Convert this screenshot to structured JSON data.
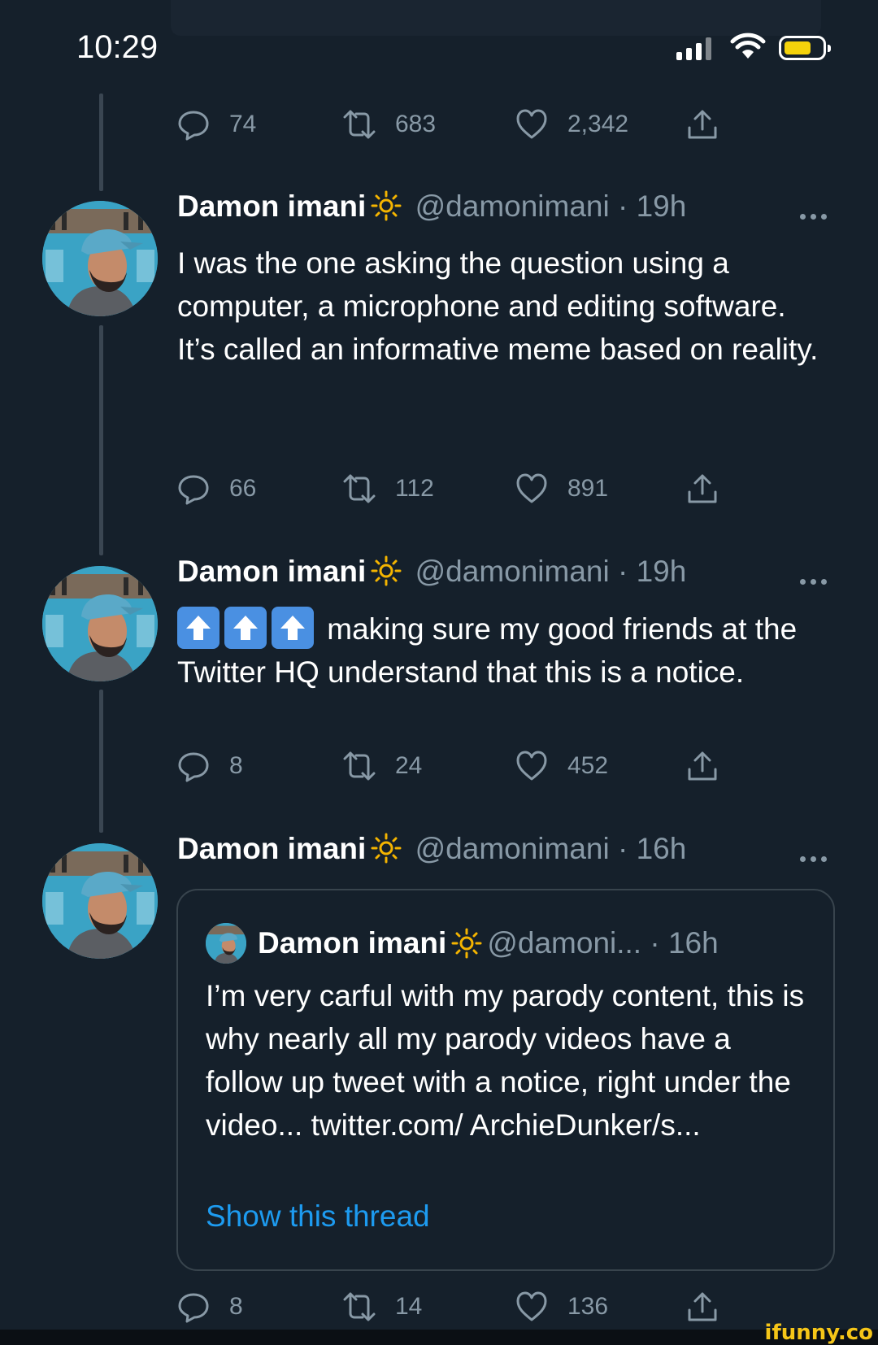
{
  "status_bar": {
    "time": "10:29"
  },
  "colors": {
    "background": "#15202b",
    "accent": "#1d9bf0",
    "muted": "#8899a6",
    "battery": "#f4d20b"
  },
  "tweets": [
    {
      "actions": {
        "replies": "74",
        "retweets": "683",
        "likes": "2,342"
      }
    },
    {
      "author": {
        "name": "Damon imani",
        "handle": "@damonimani",
        "time": "· 19h"
      },
      "text": [
        "I was the one asking the question using a computer, a microphone and editing software.",
        "It’s called an informative meme based on reality."
      ],
      "actions": {
        "replies": "66",
        "retweets": "112",
        "likes": "891"
      }
    },
    {
      "author": {
        "name": "Damon imani",
        "handle": "@damonimani",
        "time": "· 19h"
      },
      "text": [
        "making sure my good friends at the Twitter HQ understand that this is a notice."
      ],
      "actions": {
        "replies": "8",
        "retweets": "24",
        "likes": "452"
      }
    },
    {
      "author": {
        "name": "Damon imani",
        "handle": "@damonimani",
        "time": "· 16h"
      },
      "quote": {
        "name": "Damon imani",
        "handle": "@damoni...",
        "time": "· 16h",
        "text": "I’m very carful with my parody content, this is why nearly all my parody videos have a follow up tweet with a notice, right under the video... twitter.com/ ArchieDunker/s...",
        "show_thread": "Show this thread"
      },
      "actions": {
        "replies": "8",
        "retweets": "14",
        "likes": "136"
      }
    }
  ],
  "watermark": "ifunny.co"
}
